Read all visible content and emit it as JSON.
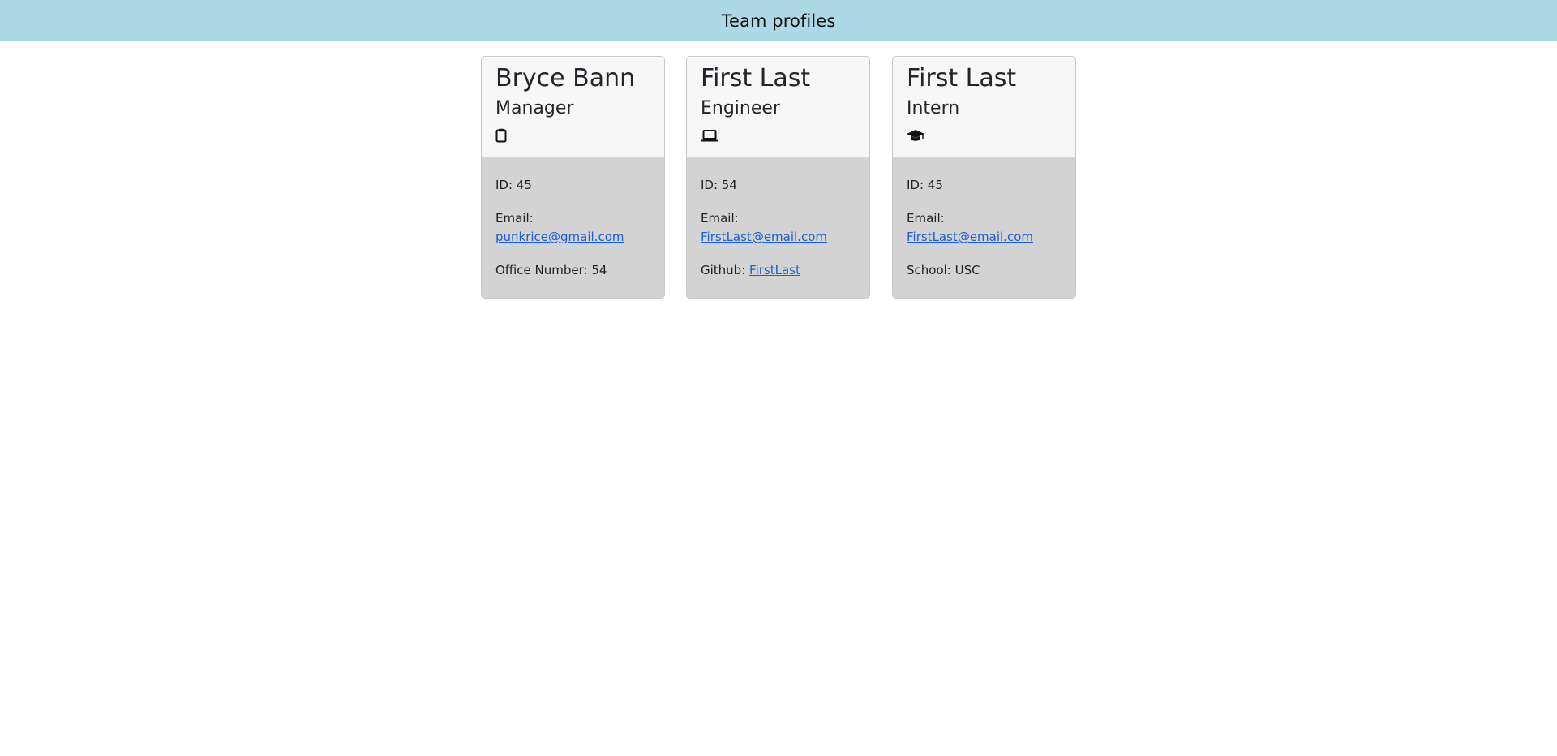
{
  "header": {
    "title": "Team profiles"
  },
  "cards": [
    {
      "name": "Bryce Bann",
      "role": "Manager",
      "icon": "clipboard-icon",
      "id_label": "ID: ",
      "id_value": "45",
      "email_label": "Email: ",
      "email_value": "punkrice@gmail.com",
      "extra_label": "Office Number: ",
      "extra_value": "54"
    },
    {
      "name": "First Last",
      "role": "Engineer",
      "icon": "laptop-icon",
      "id_label": "ID: ",
      "id_value": "54",
      "email_label": "Email: ",
      "email_value": "FirstLast@email.com",
      "extra_label": "Github: ",
      "extra_value": "FirstLast"
    },
    {
      "name": "First Last",
      "role": "Intern",
      "icon": "graduation-cap-icon",
      "id_label": "ID: ",
      "id_value": "45",
      "email_label": "Email: ",
      "email_value": "FirstLast@email.com",
      "extra_label": "School: ",
      "extra_value": "USC"
    }
  ],
  "colors": {
    "header_bg": "#add8e6",
    "card_header_bg": "#f7f7f7",
    "card_body_bg": "#d3d3d3",
    "link": "#1a5fd6"
  }
}
